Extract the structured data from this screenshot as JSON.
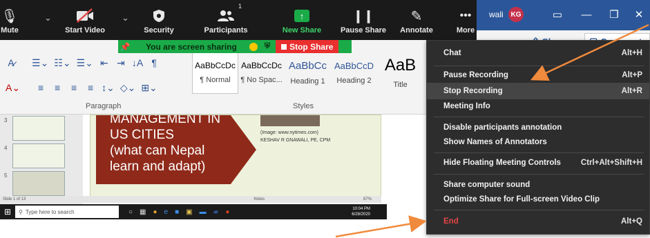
{
  "word": {
    "user_name": "wali",
    "avatar_initials": "KG",
    "share_label": "Share",
    "comments_label": "Comments",
    "paragraph_group": "Paragraph",
    "styles_group": "Styles",
    "styles": [
      {
        "sample": "AaBbCcDc",
        "name": "¶ Normal"
      },
      {
        "sample": "AaBbCcDc",
        "name": "¶ No Spac..."
      },
      {
        "sample": "AaBbCc",
        "name": "Heading 1"
      },
      {
        "sample": "AaBbCcD",
        "name": "Heading 2"
      },
      {
        "sample": "AaB",
        "name": "Title"
      }
    ]
  },
  "slide": {
    "title_lines": [
      "MANAGEMENT IN",
      "US CITIES",
      "(what can Nepal",
      "learn and adapt)"
    ],
    "image_credit": "(Image: www.nytimes.com)",
    "author": "KESHAV R GNAWALI, PE, CPM",
    "status_text": "Slide 1 of 13",
    "notes_label": "Notes",
    "zoom_text": "87%"
  },
  "taskbar": {
    "search_placeholder": "Type here to search",
    "time": "10:04 PM",
    "date": "6/28/2020"
  },
  "zoom_toolbar": {
    "items": [
      {
        "label": "Mute",
        "icon": "microphone-icon"
      },
      {
        "label": "Start Video",
        "icon": "video-off-icon"
      },
      {
        "label": "Security",
        "icon": "shield-icon"
      },
      {
        "label": "Participants",
        "icon": "participants-icon",
        "count": "1"
      },
      {
        "label": "New Share",
        "icon": "new-share-icon"
      },
      {
        "label": "Pause Share",
        "icon": "pause-icon"
      },
      {
        "label": "Annotate",
        "icon": "pen-icon"
      },
      {
        "label": "More",
        "icon": "more-icon"
      }
    ],
    "colors": {
      "toolbar_bg": "#1a1a1a",
      "new_share_green": "#1aab48"
    }
  },
  "share_banner": {
    "text": "You are screen sharing",
    "stop_label": "Stop Share",
    "colors": {
      "banner": "#1aab48",
      "stop": "#ea2f2f"
    }
  },
  "more_menu": {
    "items": [
      {
        "label": "Chat",
        "shortcut": "Alt+H"
      },
      {
        "label": "Pause Recording",
        "shortcut": "Alt+P"
      },
      {
        "label": "Stop Recording",
        "shortcut": "Alt+R"
      },
      {
        "label": "Meeting Info",
        "shortcut": ""
      },
      {
        "label": "Disable participants annotation",
        "shortcut": ""
      },
      {
        "label": "Show Names of Annotators",
        "shortcut": ""
      },
      {
        "label": "Hide Floating Meeting Controls",
        "shortcut": "Ctrl+Alt+Shift+H"
      },
      {
        "label": "Share computer sound",
        "shortcut": ""
      },
      {
        "label": "Optimize Share for Full-screen Video Clip",
        "shortcut": ""
      },
      {
        "label": "End",
        "shortcut": "Alt+Q"
      }
    ],
    "colors": {
      "menu_bg": "#2d2d2d",
      "highlight": "#454545",
      "end_red": "#e64646"
    }
  },
  "annotation_color": "#f08a3c"
}
